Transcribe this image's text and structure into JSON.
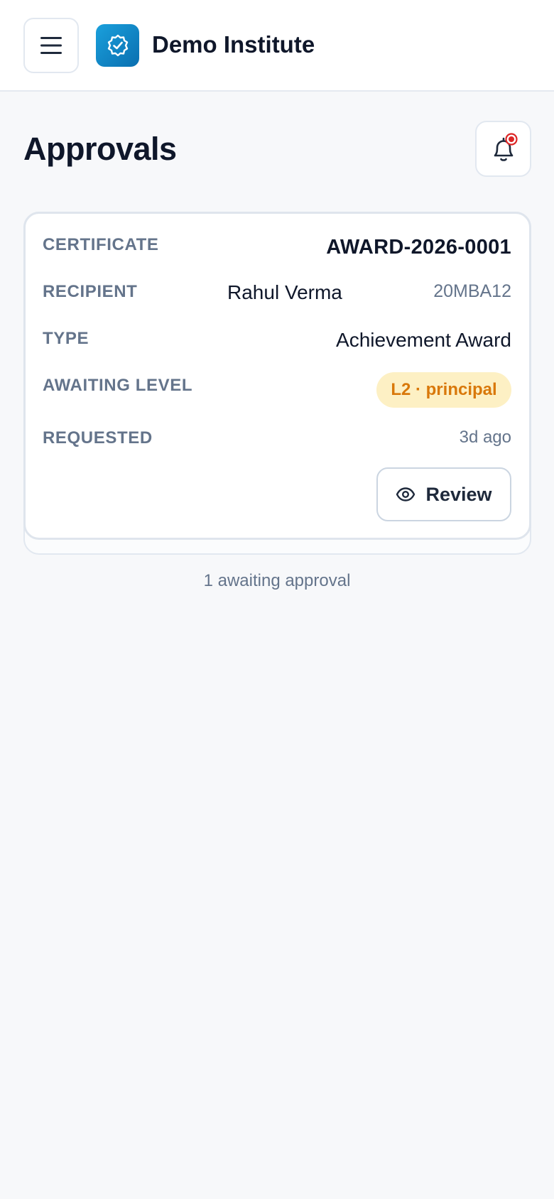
{
  "header": {
    "brand": "Demo Institute",
    "menu_icon": "hamburger-menu-icon",
    "logo_icon": "verified-badge-icon"
  },
  "page": {
    "title": "Approvals",
    "notification_icon": "bell-icon",
    "notification_dot_color": "#dc2626"
  },
  "approval": {
    "certificate_label": "CERTIFICATE",
    "certificate_value": "AWARD-2026-0001",
    "recipient_label": "RECIPIENT",
    "recipient_name": "Rahul Verma",
    "recipient_id": "20MBA12",
    "type_label": "TYPE",
    "type_value": "Achievement Award",
    "level_label": "AWAITING LEVEL",
    "level_value": "L2 · principal",
    "requested_label": "REQUESTED",
    "requested_value": "3d ago",
    "review_label": "Review",
    "review_icon": "eye-icon"
  },
  "footer": {
    "count_text": "1 awaiting approval"
  },
  "colors": {
    "accent": "#0a8fd0",
    "badge_bg": "#fdf0c4",
    "badge_text": "#d9780a"
  }
}
